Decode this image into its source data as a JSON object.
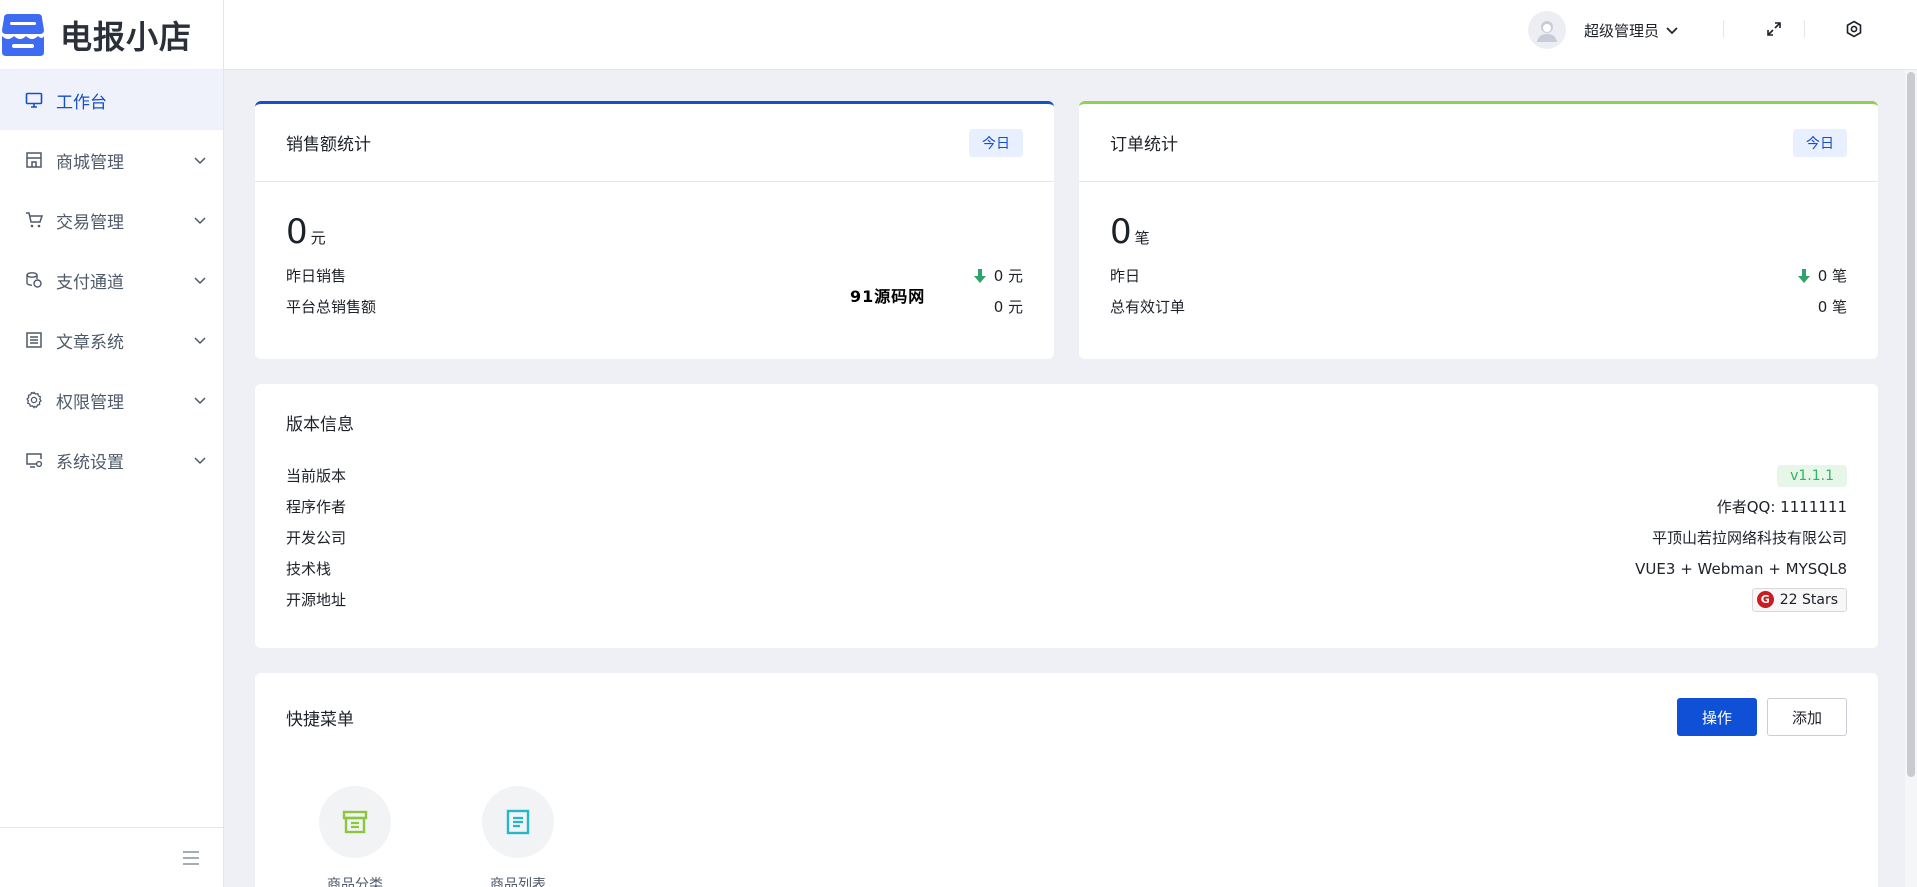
{
  "brand": {
    "name": "电报小店",
    "color": "#3d6cf2"
  },
  "sidebar": {
    "items": [
      {
        "label": "工作台",
        "icon": "monitor-icon",
        "active": true
      },
      {
        "label": "商城管理",
        "icon": "store-icon"
      },
      {
        "label": "交易管理",
        "icon": "cart-icon"
      },
      {
        "label": "支付通道",
        "icon": "coins-icon"
      },
      {
        "label": "文章系统",
        "icon": "article-icon"
      },
      {
        "label": "权限管理",
        "icon": "gear-icon"
      },
      {
        "label": "系统设置",
        "icon": "settings-monitor-icon"
      }
    ]
  },
  "header": {
    "username": "超级管理员"
  },
  "sales": {
    "title": "销售额统计",
    "tag": "今日",
    "value": "0",
    "unit": "元",
    "yesterday_label": "昨日销售",
    "yesterday_value": "0 元",
    "total_label": "平台总销售额",
    "total_value": "0 元"
  },
  "orders": {
    "title": "订单统计",
    "tag": "今日",
    "value": "0",
    "unit": "笔",
    "yesterday_label": "昨日",
    "yesterday_value": "0 笔",
    "total_label": "总有效订单",
    "total_value": "0 笔"
  },
  "version": {
    "title": "版本信息",
    "rows": [
      {
        "label": "当前版本",
        "value": "v1.1.1"
      },
      {
        "label": "程序作者",
        "value": "作者QQ: 1111111"
      },
      {
        "label": "开发公司",
        "value": "平顶山若拉网络科技有限公司"
      },
      {
        "label": "技术栈",
        "value": "VUE3 + Webman + MYSQL8"
      },
      {
        "label": "开源地址",
        "value": "22 Stars"
      }
    ]
  },
  "quick_menu": {
    "title": "快捷菜单",
    "operate_label": "操作",
    "add_label": "添加",
    "items": [
      {
        "label": "商品分类",
        "color": "#8cc63f"
      },
      {
        "label": "商品列表",
        "color": "#26b7c7"
      }
    ]
  },
  "watermark": "91源码网",
  "colors": {
    "accent": "#1650c6",
    "primary_button": "#0f50d6",
    "sales_border": "#1650c6",
    "orders_border": "#8fd14f",
    "down_arrow": "#2fa36b"
  }
}
